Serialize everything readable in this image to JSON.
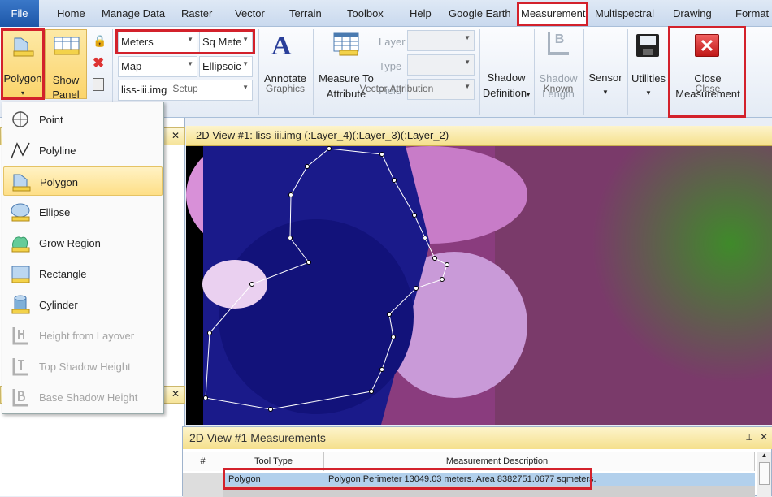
{
  "tabs": {
    "file": "File",
    "items": [
      "Home",
      "Manage Data",
      "Raster",
      "Vector",
      "Terrain",
      "Toolbox",
      "Help",
      "Google Earth",
      "Measurement",
      "Multispectral",
      "Drawing",
      "Format"
    ],
    "active": "Measurement"
  },
  "ribbon": {
    "polygon": "Polygon",
    "show_panel_1": "Show",
    "show_panel_2": "Panel",
    "units_linear": "Meters",
    "units_area": "Sq Mete",
    "coord_type": "Map",
    "ellipsoid": "Ellipsoic",
    "layer_file": "liss-iii.img",
    "setup_group": "Setup",
    "annotate": "Annotate",
    "graphics_group": "Graphics",
    "measure_to_1": "Measure To",
    "measure_to_2": "Attribute",
    "layer_label": "Layer",
    "type_label": "Type",
    "field_label": "Field",
    "vector_attr_group": "Vector Attribution",
    "shadow_def_1": "Shadow",
    "shadow_def_2": "Definition",
    "shadow_len_1": "Shadow",
    "shadow_len_2": "Length",
    "known_group": "Known",
    "sensor": "Sensor",
    "utilities": "Utilities",
    "close_1": "Close",
    "close_2": "Measurement",
    "close_group": "Close"
  },
  "menu": [
    {
      "label": "Point",
      "icon": "crosshair-icon"
    },
    {
      "label": "Polyline",
      "icon": "polyline-icon"
    },
    {
      "label": "Polygon",
      "icon": "polygon-icon",
      "selected": true
    },
    {
      "label": "Ellipse",
      "icon": "ellipse-icon"
    },
    {
      "label": "Grow Region",
      "icon": "grow-region-icon"
    },
    {
      "label": "Rectangle",
      "icon": "rectangle-icon"
    },
    {
      "label": "Cylinder",
      "icon": "cylinder-icon"
    },
    {
      "label": "Height from Layover",
      "icon": "height-icon",
      "disabled": true
    },
    {
      "label": "Top Shadow Height",
      "icon": "top-shadow-icon",
      "disabled": true
    },
    {
      "label": "Base Shadow Height",
      "icon": "base-shadow-icon",
      "disabled": true
    }
  ],
  "view": {
    "title": "2D View #1: liss-iii.img (:Layer_4)(:Layer_3)(:Layer_2)"
  },
  "measurements": {
    "title": "2D View #1 Measurements",
    "columns": [
      "#",
      "Tool Type",
      "Measurement Description"
    ],
    "rows": [
      {
        "tool": "Polygon",
        "desc": "Polygon Perimeter 13049.03 meters. Area 8382751.0677 sqmeters."
      }
    ]
  },
  "colors": {
    "highlight": "#d3212b",
    "accent": "#f5e08c"
  }
}
